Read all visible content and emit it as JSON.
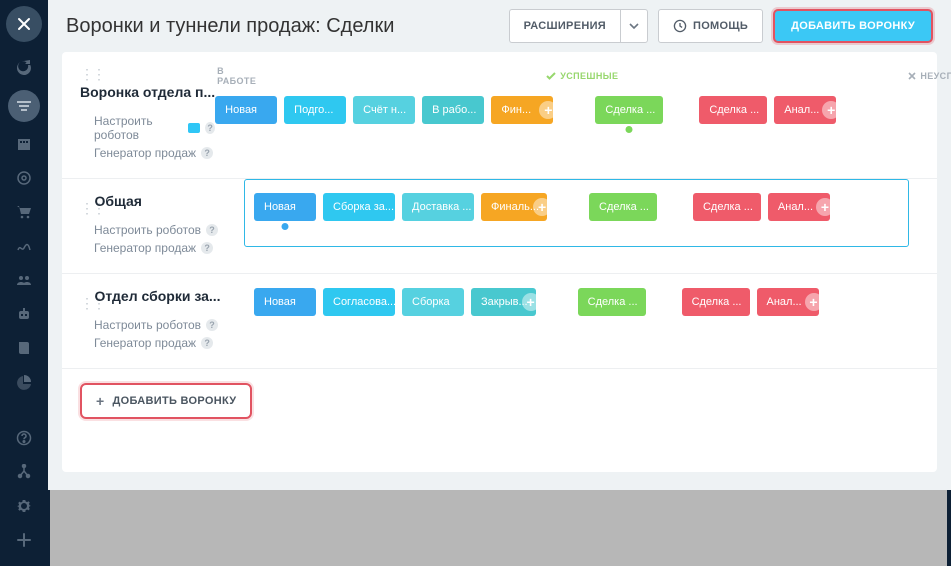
{
  "header": {
    "title": "Воронки и туннели продаж: Сделки",
    "extensions_label": "РАСШИРЕНИЯ",
    "help_label": "ПОМОЩЬ",
    "add_funnel_label": "ДОБАВИТЬ ВОРОНКУ"
  },
  "status_headers": {
    "work": "В РАБОТЕ",
    "success": "УСПЕШНЫЕ",
    "fail": "НЕУСПЕШНЫЕ"
  },
  "sublabels": {
    "robots": "Настроить роботов",
    "generator": "Генератор продаж"
  },
  "funnels": [
    {
      "name": "Воронка отдела п...",
      "show_headers": true,
      "has_robot_badge": true,
      "stages_work": [
        {
          "label": "Новая",
          "color": "c-blue1",
          "dot": false,
          "plus": false
        },
        {
          "label": "Подго...",
          "color": "c-blue2",
          "dot": false,
          "plus": false
        },
        {
          "label": "Счёт н...",
          "color": "c-teal",
          "dot": false,
          "plus": false
        },
        {
          "label": "В рабо...",
          "color": "c-cyan",
          "dot": false,
          "plus": false
        },
        {
          "label": "Фин...",
          "color": "c-orange",
          "dot": false,
          "plus": true
        }
      ],
      "stages_success": [
        {
          "label": "Сделка ...",
          "color": "c-green",
          "dot": true,
          "plus": false
        }
      ],
      "stages_fail": [
        {
          "label": "Сделка ...",
          "color": "c-red",
          "dot": false,
          "plus": false
        },
        {
          "label": "Анал...",
          "color": "c-red",
          "dot": false,
          "plus": true
        }
      ]
    },
    {
      "name": "Общая",
      "show_headers": false,
      "framed": true,
      "has_robot_badge": false,
      "stages_work": [
        {
          "label": "Новая",
          "color": "c-blue1",
          "dot": true,
          "plus": false
        },
        {
          "label": "Сборка за...",
          "color": "c-blue2",
          "dot": false,
          "plus": false
        },
        {
          "label": "Доставка ...",
          "color": "c-teal",
          "dot": false,
          "plus": false
        },
        {
          "label": "Финаль...",
          "color": "c-orange",
          "dot": false,
          "plus": true
        }
      ],
      "stages_success": [
        {
          "label": "Сделка ...",
          "color": "c-green",
          "dot": false,
          "plus": false
        }
      ],
      "stages_fail": [
        {
          "label": "Сделка ...",
          "color": "c-red",
          "dot": false,
          "plus": false
        },
        {
          "label": "Анал...",
          "color": "c-red",
          "dot": false,
          "plus": true
        }
      ]
    },
    {
      "name": "Отдел сборки за...",
      "show_headers": false,
      "has_robot_badge": false,
      "stages_work": [
        {
          "label": "Новая",
          "color": "c-blue1",
          "dot": false,
          "plus": false
        },
        {
          "label": "Согласова...",
          "color": "c-blue2",
          "dot": false,
          "plus": false
        },
        {
          "label": "Сборка",
          "color": "c-teal",
          "dot": false,
          "plus": false
        },
        {
          "label": "Закрыв...",
          "color": "c-cyan",
          "dot": false,
          "plus": true
        }
      ],
      "stages_success": [
        {
          "label": "Сделка ...",
          "color": "c-green",
          "dot": false,
          "plus": false
        }
      ],
      "stages_fail": [
        {
          "label": "Сделка ...",
          "color": "c-red",
          "dot": false,
          "plus": false
        },
        {
          "label": "Анал...",
          "color": "c-red",
          "dot": false,
          "plus": true
        }
      ]
    }
  ],
  "footer": {
    "add_funnel_label": "ДОБАВИТЬ ВОРОНКУ"
  },
  "sidebar_icons": [
    "close-icon",
    "refresh-icon",
    "filter-icon",
    "building-icon",
    "target-icon",
    "cart-icon",
    "sign-icon",
    "group-icon",
    "robot-icon",
    "book-icon",
    "pie-icon"
  ],
  "sidebar_bottom_icons": [
    "question-icon",
    "branch-icon",
    "gear-icon",
    "plus-icon"
  ]
}
